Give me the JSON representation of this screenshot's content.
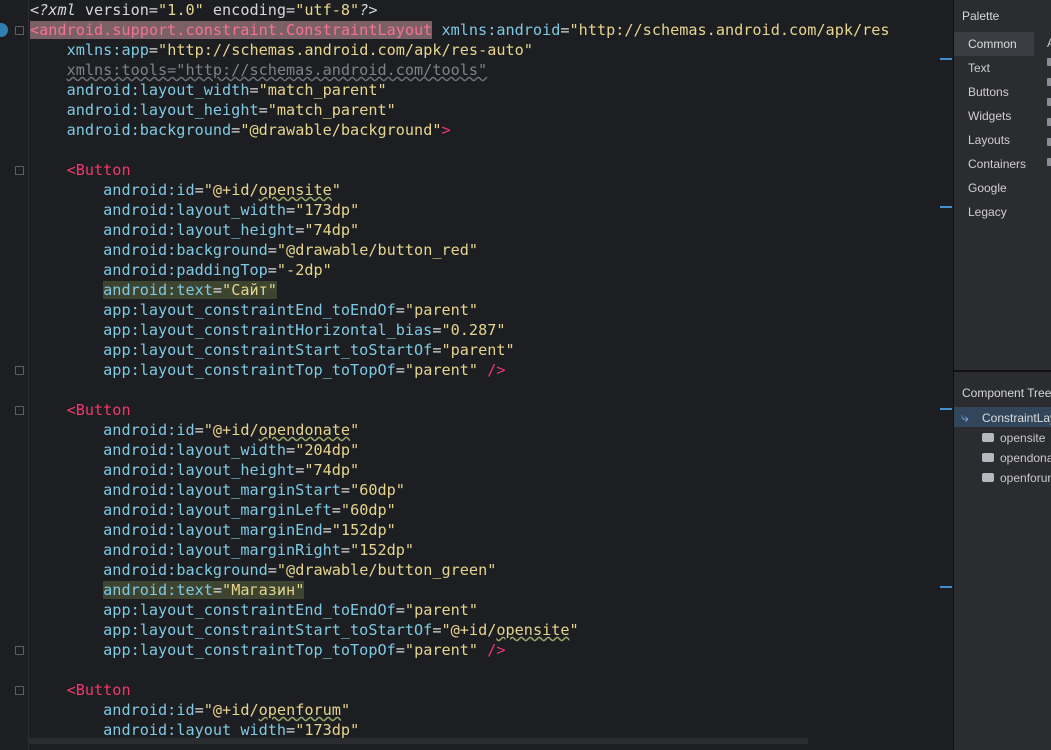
{
  "editor": {
    "lines": [
      [
        [
          "pi",
          "<?"
        ],
        [
          "pi",
          "xml "
        ],
        [
          "pi2",
          "version="
        ],
        [
          "val",
          "\"1.0\""
        ],
        [
          "pi2",
          " encoding="
        ],
        [
          "val",
          "\"utf-8\""
        ],
        [
          "pi",
          "?>"
        ]
      ],
      [
        [
          "taghl",
          "<android.support.constraint.ConstraintLayout"
        ],
        [
          "plain",
          " "
        ],
        [
          "ns",
          "xmlns:"
        ],
        [
          "attr",
          "android"
        ],
        [
          "eq",
          "="
        ],
        [
          "val",
          "\"http://schemas.android.com/apk/res"
        ]
      ],
      [
        [
          "plain",
          "    "
        ],
        [
          "ns",
          "xmlns:"
        ],
        [
          "attr",
          "app"
        ],
        [
          "eq",
          "="
        ],
        [
          "val",
          "\"http://schemas.android.com/apk/res-auto\""
        ]
      ],
      [
        [
          "plain",
          "    "
        ],
        [
          "tools",
          "xmlns:tools=\"http://schemas.android.com/tools\""
        ]
      ],
      [
        [
          "plain",
          "    "
        ],
        [
          "ns",
          "android:"
        ],
        [
          "attr",
          "layout_width"
        ],
        [
          "eq",
          "="
        ],
        [
          "val",
          "\"match_parent\""
        ]
      ],
      [
        [
          "plain",
          "    "
        ],
        [
          "ns",
          "android:"
        ],
        [
          "attr",
          "layout_height"
        ],
        [
          "eq",
          "="
        ],
        [
          "val",
          "\"match_parent\""
        ]
      ],
      [
        [
          "plain",
          "    "
        ],
        [
          "ns",
          "android:"
        ],
        [
          "attr",
          "background"
        ],
        [
          "eq",
          "="
        ],
        [
          "val",
          "\"@drawable/background\""
        ],
        [
          "punct",
          ">"
        ]
      ],
      [],
      [
        [
          "plain",
          "    "
        ],
        [
          "tag",
          "<Button"
        ]
      ],
      [
        [
          "plain",
          "        "
        ],
        [
          "ns",
          "android:"
        ],
        [
          "attr",
          "id"
        ],
        [
          "eq",
          "="
        ],
        [
          "val",
          "\"@+id/"
        ],
        [
          "valw",
          "opensite"
        ],
        [
          "val",
          "\""
        ]
      ],
      [
        [
          "plain",
          "        "
        ],
        [
          "ns",
          "android:"
        ],
        [
          "attr",
          "layout_width"
        ],
        [
          "eq",
          "="
        ],
        [
          "val",
          "\"173dp\""
        ]
      ],
      [
        [
          "plain",
          "        "
        ],
        [
          "ns",
          "android:"
        ],
        [
          "attr",
          "layout_height"
        ],
        [
          "eq",
          "="
        ],
        [
          "val",
          "\"74dp\""
        ]
      ],
      [
        [
          "plain",
          "        "
        ],
        [
          "ns",
          "android:"
        ],
        [
          "attr",
          "background"
        ],
        [
          "eq",
          "="
        ],
        [
          "val",
          "\"@drawable/button_red\""
        ]
      ],
      [
        [
          "plain",
          "        "
        ],
        [
          "ns",
          "android:"
        ],
        [
          "attr",
          "paddingTop"
        ],
        [
          "eq",
          "="
        ],
        [
          "val",
          "\"-2dp\""
        ]
      ],
      [
        [
          "plain",
          "        "
        ],
        [
          "hlns",
          "android:"
        ],
        [
          "hlattr",
          "text"
        ],
        [
          "hleq",
          "="
        ],
        [
          "hlval",
          "\"Сайт\""
        ]
      ],
      [
        [
          "plain",
          "        "
        ],
        [
          "ns",
          "app:"
        ],
        [
          "attr",
          "layout_constraintEnd_toEndOf"
        ],
        [
          "eq",
          "="
        ],
        [
          "val",
          "\"parent\""
        ]
      ],
      [
        [
          "plain",
          "        "
        ],
        [
          "ns",
          "app:"
        ],
        [
          "attr",
          "layout_constraintHorizontal_bias"
        ],
        [
          "eq",
          "="
        ],
        [
          "val",
          "\"0.287\""
        ]
      ],
      [
        [
          "plain",
          "        "
        ],
        [
          "ns",
          "app:"
        ],
        [
          "attr",
          "layout_constraintStart_toStartOf"
        ],
        [
          "eq",
          "="
        ],
        [
          "val",
          "\"parent\""
        ]
      ],
      [
        [
          "plain",
          "        "
        ],
        [
          "ns",
          "app:"
        ],
        [
          "attr",
          "layout_constraintTop_toTopOf"
        ],
        [
          "eq",
          "="
        ],
        [
          "val",
          "\"parent\""
        ],
        [
          "plain",
          " "
        ],
        [
          "punct",
          "/>"
        ]
      ],
      [],
      [
        [
          "plain",
          "    "
        ],
        [
          "tag",
          "<Button"
        ]
      ],
      [
        [
          "plain",
          "        "
        ],
        [
          "ns",
          "android:"
        ],
        [
          "attr",
          "id"
        ],
        [
          "eq",
          "="
        ],
        [
          "val",
          "\"@+id/"
        ],
        [
          "valw",
          "opendonate"
        ],
        [
          "val",
          "\""
        ]
      ],
      [
        [
          "plain",
          "        "
        ],
        [
          "ns",
          "android:"
        ],
        [
          "attr",
          "layout_width"
        ],
        [
          "eq",
          "="
        ],
        [
          "val",
          "\"204dp\""
        ]
      ],
      [
        [
          "plain",
          "        "
        ],
        [
          "ns",
          "android:"
        ],
        [
          "attr",
          "layout_height"
        ],
        [
          "eq",
          "="
        ],
        [
          "val",
          "\"74dp\""
        ]
      ],
      [
        [
          "plain",
          "        "
        ],
        [
          "ns",
          "android:"
        ],
        [
          "attr",
          "layout_marginStart"
        ],
        [
          "eq",
          "="
        ],
        [
          "val",
          "\"60dp\""
        ]
      ],
      [
        [
          "plain",
          "        "
        ],
        [
          "ns",
          "android:"
        ],
        [
          "attr",
          "layout_marginLeft"
        ],
        [
          "eq",
          "="
        ],
        [
          "val",
          "\"60dp\""
        ]
      ],
      [
        [
          "plain",
          "        "
        ],
        [
          "ns",
          "android:"
        ],
        [
          "attr",
          "layout_marginEnd"
        ],
        [
          "eq",
          "="
        ],
        [
          "val",
          "\"152dp\""
        ]
      ],
      [
        [
          "plain",
          "        "
        ],
        [
          "ns",
          "android:"
        ],
        [
          "attr",
          "layout_marginRight"
        ],
        [
          "eq",
          "="
        ],
        [
          "val",
          "\"152dp\""
        ]
      ],
      [
        [
          "plain",
          "        "
        ],
        [
          "ns",
          "android:"
        ],
        [
          "attr",
          "background"
        ],
        [
          "eq",
          "="
        ],
        [
          "val",
          "\"@drawable/button_green\""
        ]
      ],
      [
        [
          "plain",
          "        "
        ],
        [
          "hlns",
          "android:"
        ],
        [
          "hlattr",
          "text"
        ],
        [
          "hleq",
          "="
        ],
        [
          "hlval",
          "\"Магазин\""
        ]
      ],
      [
        [
          "plain",
          "        "
        ],
        [
          "ns",
          "app:"
        ],
        [
          "attr",
          "layout_constraintEnd_toEndOf"
        ],
        [
          "eq",
          "="
        ],
        [
          "val",
          "\"parent\""
        ]
      ],
      [
        [
          "plain",
          "        "
        ],
        [
          "ns",
          "app:"
        ],
        [
          "attr",
          "layout_constraintStart_toStartOf"
        ],
        [
          "eq",
          "="
        ],
        [
          "val",
          "\"@+id/"
        ],
        [
          "valw",
          "opensite"
        ],
        [
          "val",
          "\""
        ]
      ],
      [
        [
          "plain",
          "        "
        ],
        [
          "ns",
          "app:"
        ],
        [
          "attr",
          "layout_constraintTop_toTopOf"
        ],
        [
          "eq",
          "="
        ],
        [
          "val",
          "\"parent\""
        ],
        [
          "plain",
          " "
        ],
        [
          "punct",
          "/>"
        ]
      ],
      [],
      [
        [
          "plain",
          "    "
        ],
        [
          "tag",
          "<Button"
        ]
      ],
      [
        [
          "plain",
          "        "
        ],
        [
          "ns",
          "android:"
        ],
        [
          "attr",
          "id"
        ],
        [
          "eq",
          "="
        ],
        [
          "val",
          "\"@+id/"
        ],
        [
          "valw",
          "openforum"
        ],
        [
          "val",
          "\""
        ]
      ],
      [
        [
          "plain",
          "        "
        ],
        [
          "ns",
          "android:"
        ],
        [
          "attr",
          "layout_width"
        ],
        [
          "eq",
          "="
        ],
        [
          "val",
          "\"173dp\""
        ]
      ]
    ]
  },
  "palette": {
    "title": "Palette",
    "categories": [
      "Common",
      "Text",
      "Buttons",
      "Widgets",
      "Layouts",
      "Containers",
      "Google",
      "Legacy"
    ],
    "selected": "Common",
    "right_header": "A"
  },
  "component_tree": {
    "title": "Component Tree",
    "root": "ConstraintLayout",
    "items": [
      "opensite",
      "opendonate",
      "openforum"
    ]
  }
}
